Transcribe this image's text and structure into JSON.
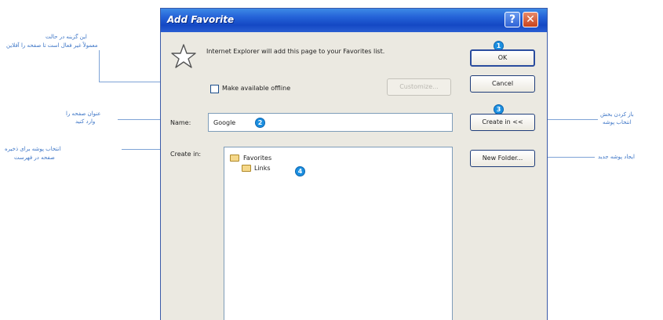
{
  "dialog": {
    "title": "Add Favorite",
    "help_glyph": "?",
    "close_glyph": "✕",
    "message": "Internet Explorer will add this page to your Favorites list.",
    "ok_label": "OK",
    "cancel_label": "Cancel",
    "make_offline_label": "Make available offline",
    "make_offline_checked": false,
    "customize_label": "Customize...",
    "name_label": "Name:",
    "name_value": "Google",
    "create_in_label": "Create in:",
    "create_in_button_label": "Create in <<",
    "new_folder_label": "New Folder...",
    "tree": [
      {
        "label": "Favorites",
        "level": 0
      },
      {
        "label": "Links",
        "level": 1
      }
    ],
    "badges": {
      "ok": "1",
      "name": "2",
      "create_in": "3",
      "links": "4"
    }
  },
  "annotations": {
    "left_offline_1": "این گزینه در حالت",
    "left_offline_2": "معمولاً غیر فعال است تا صفحه را آفلاین",
    "left_name_1": "عنوان صفحه را",
    "left_name_2": "وارد کنید",
    "left_create_1": "انتخاب پوشه برای ذخیره",
    "left_create_2": "صفحه در فهرست",
    "right_create_1": "باز کردن بخش",
    "right_create_2": "انتخاب پوشه",
    "right_newfolder": "ایجاد پوشه جدید"
  },
  "colors": {
    "titlebar": "#2563d8",
    "badge": "#1b8fe0",
    "annotation": "#3b74c6"
  }
}
